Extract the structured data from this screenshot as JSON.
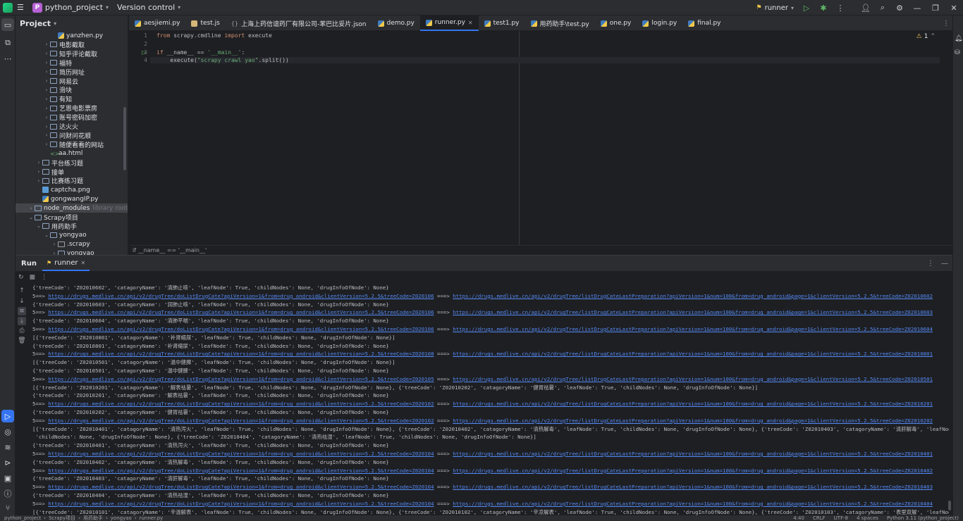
{
  "titlebar": {
    "project_badge": "P",
    "project_name": "python_project",
    "vcs": "Version control",
    "run_config": "runner"
  },
  "project_panel": {
    "title": "Project",
    "items": [
      {
        "label": "yanzhen.py",
        "kind": "py",
        "indent": 4,
        "arrow": ""
      },
      {
        "label": "电影截取",
        "kind": "folder",
        "indent": 3,
        "arrow": ">"
      },
      {
        "label": "知乎评论截取",
        "kind": "folder",
        "indent": 3,
        "arrow": ">"
      },
      {
        "label": "福特",
        "kind": "folder",
        "indent": 3,
        "arrow": ">"
      },
      {
        "label": "简历网址",
        "kind": "folder",
        "indent": 3,
        "arrow": ">"
      },
      {
        "label": "网易云",
        "kind": "folder",
        "indent": 3,
        "arrow": ">"
      },
      {
        "label": "滑块",
        "kind": "folder",
        "indent": 3,
        "arrow": ">"
      },
      {
        "label": "有知",
        "kind": "folder",
        "indent": 3,
        "arrow": ">"
      },
      {
        "label": "艺恩电影票房",
        "kind": "folder",
        "indent": 3,
        "arrow": ">"
      },
      {
        "label": "账号密码加密",
        "kind": "folder",
        "indent": 3,
        "arrow": ">"
      },
      {
        "label": "达火火",
        "kind": "folder",
        "indent": 3,
        "arrow": ">"
      },
      {
        "label": "问财问花顺",
        "kind": "folder",
        "indent": 3,
        "arrow": ">"
      },
      {
        "label": "随便看看的网站",
        "kind": "folder",
        "indent": 3,
        "arrow": ">"
      },
      {
        "label": "aa.html",
        "kind": "html",
        "indent": 3,
        "arrow": ""
      },
      {
        "label": "平台练习题",
        "kind": "folder",
        "indent": 2,
        "arrow": ">"
      },
      {
        "label": "接单",
        "kind": "folder",
        "indent": 2,
        "arrow": ">"
      },
      {
        "label": "比赛练习题",
        "kind": "folder",
        "indent": 2,
        "arrow": ">"
      },
      {
        "label": "captcha.png",
        "kind": "img",
        "indent": 2,
        "arrow": ""
      },
      {
        "label": "gongwangIP.py",
        "kind": "py",
        "indent": 2,
        "arrow": ""
      },
      {
        "label": "node_modules",
        "kind": "folder",
        "indent": 1,
        "arrow": ">",
        "suffix": "library root",
        "selected": true
      },
      {
        "label": "Scrapy项目",
        "kind": "folder",
        "indent": 1,
        "arrow": "v"
      },
      {
        "label": "用药助手",
        "kind": "folder",
        "indent": 2,
        "arrow": "v"
      },
      {
        "label": "yongyao",
        "kind": "folder",
        "indent": 3,
        "arrow": "v"
      },
      {
        "label": ".scrapy",
        "kind": "folder-special",
        "indent": 4,
        "arrow": ">"
      },
      {
        "label": "yongyao",
        "kind": "folder",
        "indent": 4,
        "arrow": ">"
      }
    ]
  },
  "tabs": [
    {
      "label": "aesjiemi.py",
      "icon": "py"
    },
    {
      "label": "test.js",
      "icon": "js"
    },
    {
      "label": "上海上药信谊药厂有限公司-苯巴比妥片.json",
      "icon": "json"
    },
    {
      "label": "demo.py",
      "icon": "py"
    },
    {
      "label": "runner.py",
      "icon": "py",
      "active": true
    },
    {
      "label": "test1.py",
      "icon": "py"
    },
    {
      "label": "用药助手\\test.py",
      "icon": "py"
    },
    {
      "label": "one.py",
      "icon": "py"
    },
    {
      "label": "login.py",
      "icon": "py"
    },
    {
      "label": "final.py",
      "icon": "py"
    }
  ],
  "editor": {
    "lines": [
      {
        "num": "1",
        "html_kw1": "from",
        "t1": " scrapy.cmdline ",
        "html_kw2": "import",
        "t2": " execute"
      },
      {
        "num": "2"
      },
      {
        "num": "3",
        "html_kw1": "if",
        "t1": " __name__ == ",
        "s1": "'__main__'",
        "t2": ":"
      },
      {
        "num": "4",
        "t1": "    execute(",
        "s1": "\"scrapy crawl yao\"",
        "t2": ".split())"
      }
    ],
    "warning_count": "1",
    "breadcrumb": "if __name__ == '__main__'"
  },
  "run_panel": {
    "title": "Run",
    "tab": "runner",
    "console": [
      {
        "t": "{'treeCode': 'Z02010602', 'catagoryName': '清肺止咳', 'leafNode': True, 'childNodes': None, 'drugInfoOfNode': None}"
      },
      {
        "pre": "5==> ",
        "l1": "https://drugs.medlive.cn/api/v2/drugTree/doListDrugCate?apiVersion=1&from=drug_android&clientVersion=5.2.5&treeCode=Z020106",
        "mid": " ===> ",
        "l2": "https://drugs.medlive.cn/api/v2/drugTree/listDrugCateLastPreparation?apiVersion=1&num=100&from=drug_android&page=1&clientVersion=5.2.5&treeCode=Z02010602"
      },
      {
        "t": "{'treeCode': 'Z02010603', 'catagoryName': '润肺止咳', 'leafNode': True, 'childNodes': None, 'drugInfoOfNode': None}"
      },
      {
        "pre": "5==> ",
        "l1": "https://drugs.medlive.cn/api/v2/drugTree/doListDrugCate?apiVersion=1&from=drug_android&clientVersion=5.2.5&treeCode=Z020106",
        "mid": " ===> ",
        "l2": "https://drugs.medlive.cn/api/v2/drugTree/listDrugCateLastPreparation?apiVersion=1&num=100&from=drug_android&page=1&clientVersion=5.2.5&treeCode=Z02010603"
      },
      {
        "t": "{'treeCode': 'Z02010604', 'catagoryName': '清肺平喘', 'leafNode': True, 'childNodes': None, 'drugInfoOfNode': None}"
      },
      {
        "pre": "5==> ",
        "l1": "https://drugs.medlive.cn/api/v2/drugTree/doListDrugCate?apiVersion=1&from=drug_android&clientVersion=5.2.5&treeCode=Z020106",
        "mid": " ===> ",
        "l2": "https://drugs.medlive.cn/api/v2/drugTree/listDrugCateLastPreparation?apiVersion=1&num=100&from=drug_android&page=1&clientVersion=5.2.5&treeCode=Z02010604"
      },
      {
        "t": "[{'treeCode': 'Z02010801', 'catagoryName': '补肾缩尿', 'leafNode': True, 'childNodes': None, 'drugInfoOfNode': None}]"
      },
      {
        "t": "{'treeCode': 'Z02010801', 'catagoryName': '补肾缩尿', 'leafNode': True, 'childNodes': None, 'drugInfoOfNode': None}"
      },
      {
        "pre": "5==> ",
        "l1": "https://drugs.medlive.cn/api/v2/drugTree/doListDrugCate?apiVersion=1&from=drug_android&clientVersion=5.2.5&treeCode=Z020108",
        "mid": " ===> ",
        "l2": "https://drugs.medlive.cn/api/v2/drugTree/listDrugCateLastPreparation?apiVersion=1&num=100&from=drug_android&page=1&clientVersion=5.2.5&treeCode=Z02010801"
      },
      {
        "t": "[{'treeCode': 'Z02010501', 'catagoryName': '温中健脾', 'leafNode': True, 'childNodes': None, 'drugInfoOfNode': None}]"
      },
      {
        "t": "{'treeCode': 'Z02010501', 'catagoryName': '温中健脾', 'leafNode': True, 'childNodes': None, 'drugInfoOfNode': None}"
      },
      {
        "pre": "5==> ",
        "l1": "https://drugs.medlive.cn/api/v2/drugTree/doListDrugCate?apiVersion=1&from=drug_android&clientVersion=5.2.5&treeCode=Z020105",
        "mid": " ===> ",
        "l2": "https://drugs.medlive.cn/api/v2/drugTree/listDrugCateLastPreparation?apiVersion=1&num=100&from=drug_android&page=1&clientVersion=5.2.5&treeCode=Z02010501"
      },
      {
        "t": "[{'treeCode': 'Z02010201', 'catagoryName': '解表祛暑', 'leafNode': True, 'childNodes': None, 'drugInfoOfNode': None}, {'treeCode': 'Z02010202', 'catagoryName': '健胃祛暑', 'leafNode': True, 'childNodes': None, 'drugInfoOfNode': None}]"
      },
      {
        "t": "{'treeCode': 'Z02010201', 'catagoryName': '解表祛暑', 'leafNode': True, 'childNodes': None, 'drugInfoOfNode': None}"
      },
      {
        "pre": "5==> ",
        "l1": "https://drugs.medlive.cn/api/v2/drugTree/doListDrugCate?apiVersion=1&from=drug_android&clientVersion=5.2.5&treeCode=Z020102",
        "mid": " ===> ",
        "l2": "https://drugs.medlive.cn/api/v2/drugTree/listDrugCateLastPreparation?apiVersion=1&num=100&from=drug_android&page=1&clientVersion=5.2.5&treeCode=Z02010201"
      },
      {
        "t": "{'treeCode': 'Z02010202', 'catagoryName': '健胃祛暑', 'leafNode': True, 'childNodes': None, 'drugInfoOfNode': None}"
      },
      {
        "pre": "5==> ",
        "l1": "https://drugs.medlive.cn/api/v2/drugTree/doListDrugCate?apiVersion=1&from=drug_android&clientVersion=5.2.5&treeCode=Z020102",
        "mid": " ===> ",
        "l2": "https://drugs.medlive.cn/api/v2/drugTree/listDrugCateLastPreparation?apiVersion=1&num=100&from=drug_android&page=1&clientVersion=5.2.5&treeCode=Z02010202"
      },
      {
        "t": "[{'treeCode': 'Z02010401', 'catagoryName': '清热泻火', 'leafNode': True, 'childNodes': None, 'drugInfoOfNode': None}, {'treeCode': 'Z02010402', 'catagoryName': '清热解毒', 'leafNode': True, 'childNodes': None, 'drugInfoOfNode': None}, {'treeCode': 'Z02010403', 'catagoryName': '清肝解毒', 'leafNode': True,"
      },
      {
        "t": " 'childNodes': None, 'drugInfoOfNode': None}, {'treeCode': 'Z02010404', 'catagoryName': '清热祛湿', 'leafNode': True, 'childNodes': None, 'drugInfoOfNode': None}]"
      },
      {
        "t": "{'treeCode': 'Z02010401', 'catagoryName': '清热泻火', 'leafNode': True, 'childNodes': None, 'drugInfoOfNode': None}"
      },
      {
        "pre": "5==> ",
        "l1": "https://drugs.medlive.cn/api/v2/drugTree/doListDrugCate?apiVersion=1&from=drug_android&clientVersion=5.2.5&treeCode=Z020104",
        "mid": " ===> ",
        "l2": "https://drugs.medlive.cn/api/v2/drugTree/listDrugCateLastPreparation?apiVersion=1&num=100&from=drug_android&page=1&clientVersion=5.2.5&treeCode=Z02010401"
      },
      {
        "t": "{'treeCode': 'Z02010402', 'catagoryName': '清热解毒', 'leafNode': True, 'childNodes': None, 'drugInfoOfNode': None}"
      },
      {
        "pre": "5==> ",
        "l1": "https://drugs.medlive.cn/api/v2/drugTree/doListDrugCate?apiVersion=1&from=drug_android&clientVersion=5.2.5&treeCode=Z020104",
        "mid": " ===> ",
        "l2": "https://drugs.medlive.cn/api/v2/drugTree/listDrugCateLastPreparation?apiVersion=1&num=100&from=drug_android&page=1&clientVersion=5.2.5&treeCode=Z02010402"
      },
      {
        "t": "{'treeCode': 'Z02010403', 'catagoryName': '清肝解毒', 'leafNode': True, 'childNodes': None, 'drugInfoOfNode': None}"
      },
      {
        "pre": "5==> ",
        "l1": "https://drugs.medlive.cn/api/v2/drugTree/doListDrugCate?apiVersion=1&from=drug_android&clientVersion=5.2.5&treeCode=Z020104",
        "mid": " ===> ",
        "l2": "https://drugs.medlive.cn/api/v2/drugTree/listDrugCateLastPreparation?apiVersion=1&num=100&from=drug_android&page=1&clientVersion=5.2.5&treeCode=Z02010403"
      },
      {
        "t": "{'treeCode': 'Z02010404', 'catagoryName': '清热祛湿', 'leafNode': True, 'childNodes': None, 'drugInfoOfNode': None}"
      },
      {
        "pre": "5==> ",
        "l1": "https://drugs.medlive.cn/api/v2/drugTree/doListDrugCate?apiVersion=1&from=drug_android&clientVersion=5.2.5&treeCode=Z020104",
        "mid": " ===> ",
        "l2": "https://drugs.medlive.cn/api/v2/drugTree/listDrugCateLastPreparation?apiVersion=1&num=100&from=drug_android&page=1&clientVersion=5.2.5&treeCode=Z02010404"
      },
      {
        "t": "[{'treeCode': 'Z02010101', 'catagoryName': '辛温解表', 'leafNode': True, 'childNodes': None, 'drugInfoOfNode': None}, {'treeCode': 'Z02010102', 'catagoryName': '辛凉解表', 'leafNode': True, 'childNodes': None, 'drugInfoOfNode': None}, {'treeCode': 'Z02010103', 'catagoryName': '表里双解', 'leafNode': True,"
      }
    ]
  },
  "statusbar": {
    "path": [
      "python_project",
      "Scrapy项目",
      "用药助手",
      "yongyao",
      "runner.py"
    ],
    "position": "4:40",
    "line_sep": "CRLF",
    "encoding": "UTF-8",
    "indent": "4 spaces",
    "interpreter": "Python 3.11 (python_project)"
  }
}
